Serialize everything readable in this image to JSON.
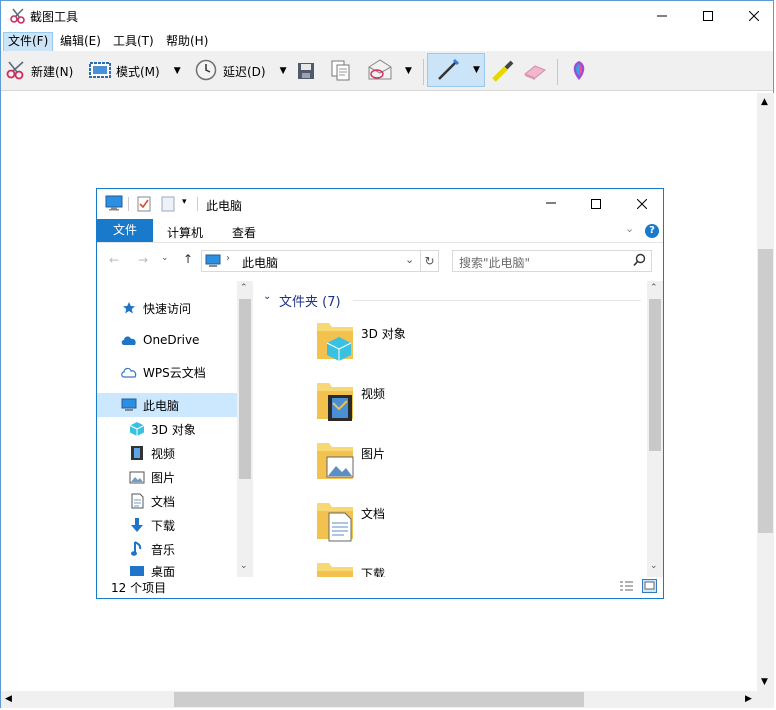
{
  "window": {
    "title": "截图工具"
  },
  "menu": [
    "文件(F)",
    "编辑(E)",
    "工具(T)",
    "帮助(H)"
  ],
  "toolbar": {
    "new_label": "新建(N)",
    "mode_label": "模式(M)",
    "delay_label": "延迟(D)"
  },
  "explorer": {
    "title": "此电脑",
    "tabs": [
      "文件",
      "计算机",
      "查看"
    ],
    "address": "此电脑",
    "search_placeholder": "搜索\"此电脑\"",
    "nav": [
      "快速访问",
      "OneDrive",
      "WPS云文档",
      "此电脑",
      "3D 对象",
      "视频",
      "图片",
      "文档",
      "下载",
      "音乐",
      "桌面"
    ],
    "group_header": "文件夹 (7)",
    "folders": [
      "3D 对象",
      "视频",
      "图片",
      "文档",
      "下载"
    ],
    "status": "12 个项目"
  },
  "colors": {
    "accent": "#0078d7",
    "border": "#1979ca",
    "header_text": "#1e3287"
  }
}
